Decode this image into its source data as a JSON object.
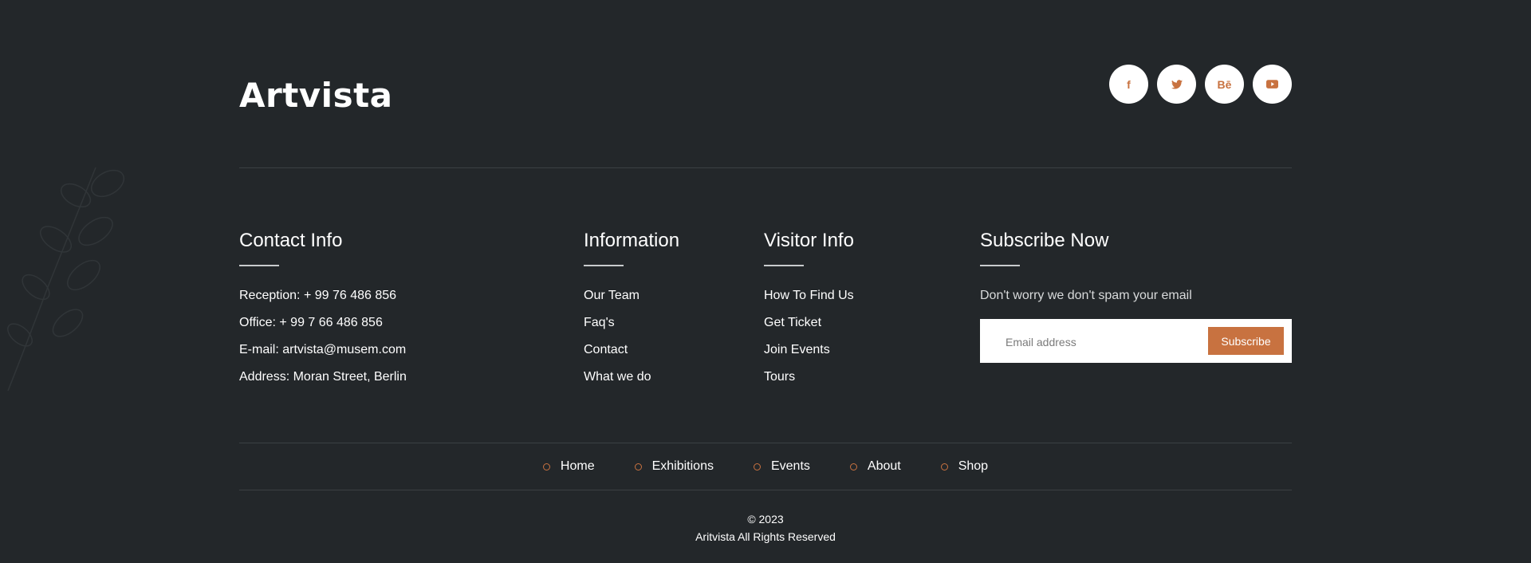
{
  "brand": {
    "name": "Artvista"
  },
  "social": [
    {
      "icon": "facebook-icon",
      "label": "f"
    },
    {
      "icon": "twitter-icon",
      "label": ""
    },
    {
      "icon": "behance-icon",
      "label": "Bē"
    },
    {
      "icon": "youtube-icon",
      "label": ""
    }
  ],
  "contact": {
    "title": "Contact Info",
    "items": [
      "Reception: + 99 76 486 856",
      "Office: + 99 7 66 486 856",
      "E-mail: artvista@musem.com",
      "Address: Moran Street, Berlin"
    ]
  },
  "information": {
    "title": "Information",
    "items": [
      "Our Team",
      "Faq's",
      "Contact",
      "What we do"
    ]
  },
  "visitor": {
    "title": "Visitor Info",
    "items": [
      "How To Find Us",
      "Get Ticket",
      "Join Events",
      "Tours"
    ]
  },
  "subscribe": {
    "title": "Subscribe Now",
    "note": "Don't worry we don't spam your email",
    "placeholder": "Email address",
    "button": "Subscribe"
  },
  "bottom_nav": [
    "Home",
    "Exhibitions",
    "Events",
    "About",
    "Shop"
  ],
  "copyright": {
    "year": "© 2023",
    "text": "Aritvista All Rights Reserved"
  },
  "colors": {
    "background": "#23272a",
    "accent": "#c87240"
  }
}
